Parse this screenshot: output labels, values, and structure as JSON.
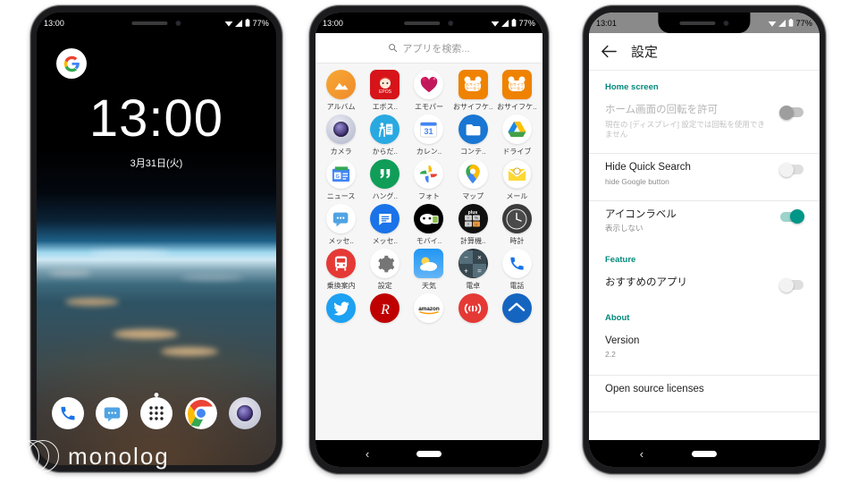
{
  "watermark": {
    "text": "monolog"
  },
  "phone1": {
    "statusbar": {
      "time": "13:00",
      "battery": "77%"
    },
    "lock": {
      "time": "13:00",
      "date": "3月31日(火)"
    },
    "google_badge": "G",
    "dock": [
      {
        "name": "phone-app",
        "label": "電話"
      },
      {
        "name": "messaging-app",
        "label": "メッセージ"
      },
      {
        "name": "app-drawer-button",
        "label": "アプリ一覧"
      },
      {
        "name": "chrome-app",
        "label": "Chrome"
      },
      {
        "name": "camera-app",
        "label": "カメラ"
      }
    ]
  },
  "phone2": {
    "statusbar": {
      "time": "13:00",
      "battery": "77%"
    },
    "search": {
      "placeholder": "アプリを検索...",
      "icon": "search-icon"
    },
    "apps": [
      {
        "label": "アルバム",
        "icon": "album-icon"
      },
      {
        "label": "エボス..",
        "icon": "epos-icon"
      },
      {
        "label": "エモパー",
        "icon": "emopa-icon"
      },
      {
        "label": "おサイフケ..",
        "icon": "osaifu-keitai-icon"
      },
      {
        "label": "おサイフケ..",
        "icon": "osaifu-keitai-2-icon"
      },
      {
        "label": "カメラ",
        "icon": "camera-icon"
      },
      {
        "label": "からだ..",
        "icon": "karada-icon"
      },
      {
        "label": "カレン..",
        "icon": "calendar-icon"
      },
      {
        "label": "コンテ..",
        "icon": "content-manager-icon"
      },
      {
        "label": "ドライブ",
        "icon": "google-drive-icon"
      },
      {
        "label": "ニュース",
        "icon": "google-news-icon"
      },
      {
        "label": "ハング..",
        "icon": "hangouts-icon"
      },
      {
        "label": "フォト",
        "icon": "google-photos-icon"
      },
      {
        "label": "マップ",
        "icon": "google-maps-icon"
      },
      {
        "label": "メール",
        "icon": "mail-icon"
      },
      {
        "label": "メッセ..",
        "icon": "sms-messaging-icon"
      },
      {
        "label": "メッセ..",
        "icon": "google-messages-icon"
      },
      {
        "label": "モバイ..",
        "icon": "mobile-suica-icon"
      },
      {
        "label": "計算機..",
        "icon": "calculator-plus-icon"
      },
      {
        "label": "時計",
        "icon": "clock-icon"
      },
      {
        "label": "乗換案内",
        "icon": "transit-navi-icon"
      },
      {
        "label": "設定",
        "icon": "settings-gear-icon"
      },
      {
        "label": "天気",
        "icon": "weather-icon"
      },
      {
        "label": "電卓",
        "icon": "calculator-icon"
      },
      {
        "label": "電話",
        "icon": "phone-icon"
      }
    ],
    "apps_partial": [
      {
        "icon": "twitter-icon"
      },
      {
        "icon": "rakuten-icon"
      },
      {
        "icon": "amazon-icon",
        "label": "amazon"
      },
      {
        "icon": "radiko-icon"
      },
      {
        "icon": "home-app-icon"
      }
    ],
    "navbar": {
      "back": "‹",
      "home": "home-pill"
    }
  },
  "phone3": {
    "statusbar": {
      "time": "13:01",
      "battery": "77%"
    },
    "appbar": {
      "back_icon": "back-arrow-icon",
      "title": "設定"
    },
    "sections": [
      {
        "header": "Home screen",
        "rows": [
          {
            "title": "ホーム画面の回転を許可",
            "subtitle": "現在の [ディスプレイ] 設定では回転を使用できません",
            "disabled": true,
            "toggle": "off"
          },
          {
            "title": "Hide Quick Search",
            "subtitle": "hide Google button",
            "disabled": false,
            "toggle": "off"
          },
          {
            "title": "アイコンラベル",
            "subtitle": "表示しない",
            "disabled": false,
            "toggle": "on"
          }
        ]
      },
      {
        "header": "Feature",
        "rows": [
          {
            "title": "おすすめのアプリ",
            "subtitle": "",
            "disabled": false,
            "toggle": "off"
          }
        ]
      },
      {
        "header": "About",
        "rows": [
          {
            "title": "Version",
            "subtitle": "2.2",
            "toggle": "none"
          },
          {
            "title": "Open source licenses",
            "subtitle": "",
            "toggle": "none"
          }
        ]
      }
    ],
    "navbar": {
      "back": "‹",
      "home": "home-pill"
    }
  },
  "colors": {
    "accent_teal": "#00897b",
    "toggle_on": "#009688",
    "drawer_bg": "#f6f6f6",
    "statusbar_gray": "#8a8a8a"
  }
}
